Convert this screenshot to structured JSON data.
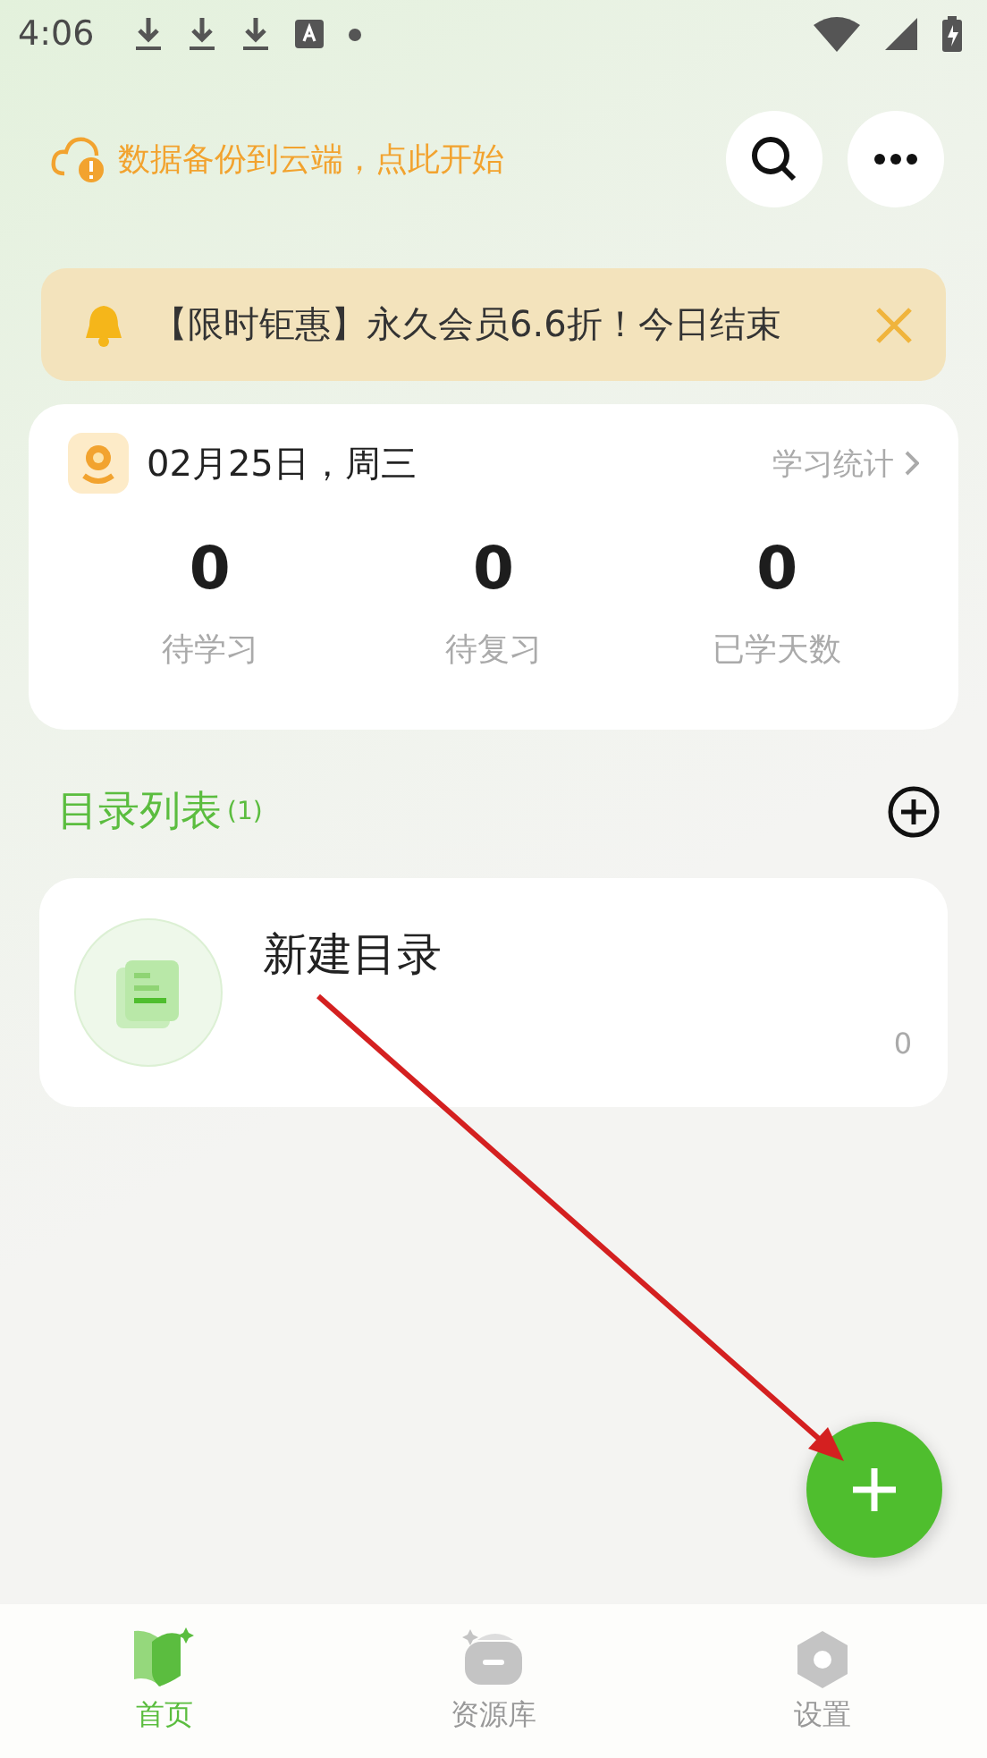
{
  "status_bar": {
    "time": "4:06",
    "notification_icons": [
      {
        "kind": "download"
      },
      {
        "kind": "download"
      },
      {
        "kind": "download"
      },
      {
        "kind": "text"
      },
      {
        "kind": "dot"
      }
    ]
  },
  "header": {
    "backup_prompt": "数据备份到云端，点此开始"
  },
  "promo_banner": {
    "text": "【限时钜惠】永久会员6.6折！今日结束"
  },
  "stats_card": {
    "date": "02月25日，周三",
    "link": "学习统计",
    "stats": [
      {
        "value": "0",
        "label": "待学习"
      },
      {
        "value": "0",
        "label": "待复习"
      },
      {
        "value": "0",
        "label": "已学天数"
      }
    ]
  },
  "section": {
    "title": "目录列表",
    "count": "(1)"
  },
  "folders": [
    {
      "name": "新建目录",
      "count": "0"
    }
  ],
  "bottom_nav": [
    {
      "label": "首页",
      "kind": "book",
      "selected": true
    },
    {
      "label": "资源库",
      "kind": "box",
      "selected": false
    },
    {
      "label": "设置",
      "kind": "gear",
      "selected": false
    }
  ]
}
